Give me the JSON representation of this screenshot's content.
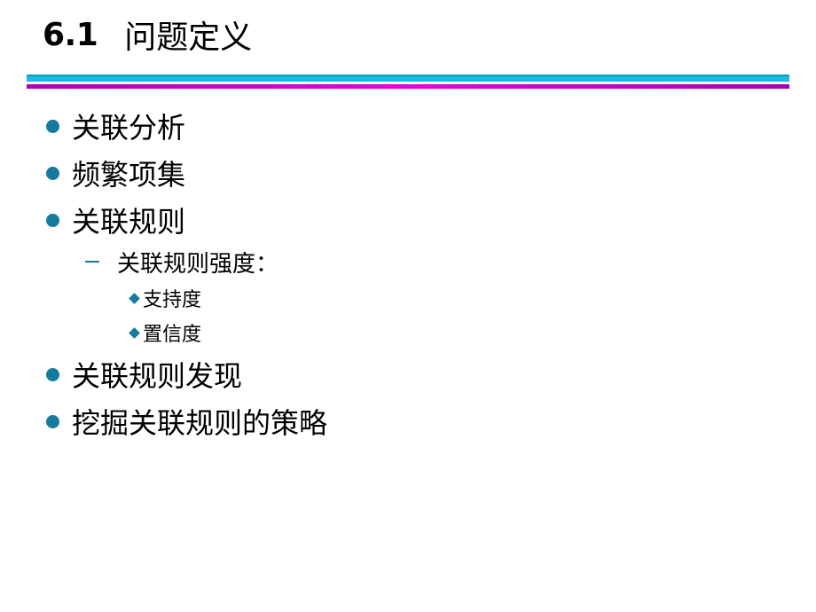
{
  "slide": {
    "title_number": "6.1",
    "title_text": "问题定义",
    "colors": {
      "bullet": "#147a9e",
      "rule_top": "#18c4e6",
      "rule_bottom": "#e000e0"
    },
    "bullets": [
      {
        "text": "关联分析",
        "level": 1
      },
      {
        "text": "频繁项集",
        "level": 1
      },
      {
        "text": "关联规则",
        "level": 1
      },
      {
        "text": "关联规则强度：",
        "level": 2
      },
      {
        "text": "支持度",
        "level": 3
      },
      {
        "text": "置信度",
        "level": 3
      },
      {
        "text": "关联规则发现",
        "level": 1
      },
      {
        "text": "挖掘关联规则的策略",
        "level": 1
      }
    ]
  }
}
